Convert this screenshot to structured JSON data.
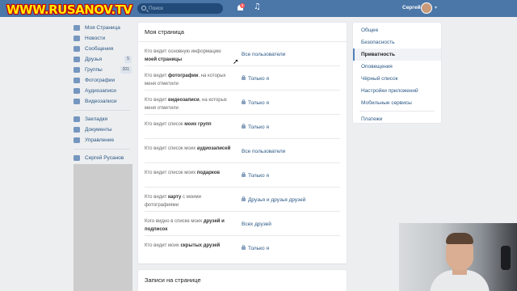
{
  "watermark": "WWW.RUSANOV.TV",
  "header": {
    "search_placeholder": "Поиск",
    "notifications_count": "2",
    "user_name": "Сергей"
  },
  "leftnav": {
    "items": [
      {
        "label": "Моя Страница",
        "icon": "house-icon"
      },
      {
        "label": "Новости",
        "icon": "news-icon"
      },
      {
        "label": "Сообщения",
        "icon": "message-icon"
      },
      {
        "label": "Друзья",
        "icon": "friends-icon",
        "count": "5"
      },
      {
        "label": "Группы",
        "icon": "groups-icon",
        "count": "201"
      },
      {
        "label": "Фотографии",
        "icon": "camera-icon"
      },
      {
        "label": "Аудиозаписи",
        "icon": "music-icon"
      },
      {
        "label": "Видеозаписи",
        "icon": "video-icon"
      }
    ],
    "items2": [
      {
        "label": "Закладки",
        "icon": "star-icon"
      },
      {
        "label": "Документы",
        "icon": "document-icon"
      },
      {
        "label": "Управление",
        "icon": "manage-icon"
      }
    ],
    "items3": [
      {
        "label": "Сергей Русанов",
        "icon": "people-icon"
      }
    ]
  },
  "main": {
    "title": "Моя страница",
    "rows": [
      {
        "label_plain": "Кто видит основную информацию ",
        "label_bold": "моей страницы",
        "label_tail": "",
        "value": "Все пользователи",
        "locked": false
      },
      {
        "label_plain": "Кто видит ",
        "label_bold": "фотографии",
        "label_tail": ", на которых меня отметили",
        "value": "Только я",
        "locked": true
      },
      {
        "label_plain": "Кто видит ",
        "label_bold": "видеозаписи",
        "label_tail": ", на которых меня отметили",
        "value": "Только я",
        "locked": true
      },
      {
        "label_plain": "Кто видит список ",
        "label_bold": "моих групп",
        "label_tail": "",
        "value": "Только я",
        "locked": true
      },
      {
        "label_plain": "Кто видит список моих ",
        "label_bold": "аудиозаписей",
        "label_tail": "",
        "value": "Все пользователи",
        "locked": false
      },
      {
        "label_plain": "Кто видит список моих ",
        "label_bold": "подарков",
        "label_tail": "",
        "value": "Только я",
        "locked": true
      },
      {
        "label_plain": "Кто видит ",
        "label_bold": "карту",
        "label_tail": " с моими фотографиями",
        "value": "Друзья и друзья друзей",
        "locked": true
      },
      {
        "label_plain": "Кого видно в списке моих ",
        "label_bold": "друзей и подписок",
        "label_tail": "",
        "value": "Всех друзей",
        "locked": false
      },
      {
        "label_plain": "Кто видит моих ",
        "label_bold": "скрытых друзей",
        "label_tail": "",
        "value": "Только я",
        "locked": true
      }
    ],
    "section2_title": "Записи на странице"
  },
  "rightmenu": {
    "group1": [
      "Общее",
      "Безопасность",
      "Приватность",
      "Оповещения",
      "Чёрный список",
      "Настройки приложений",
      "Мобильные сервисы"
    ],
    "group2": [
      "Платежи"
    ],
    "active": "Приватность"
  }
}
